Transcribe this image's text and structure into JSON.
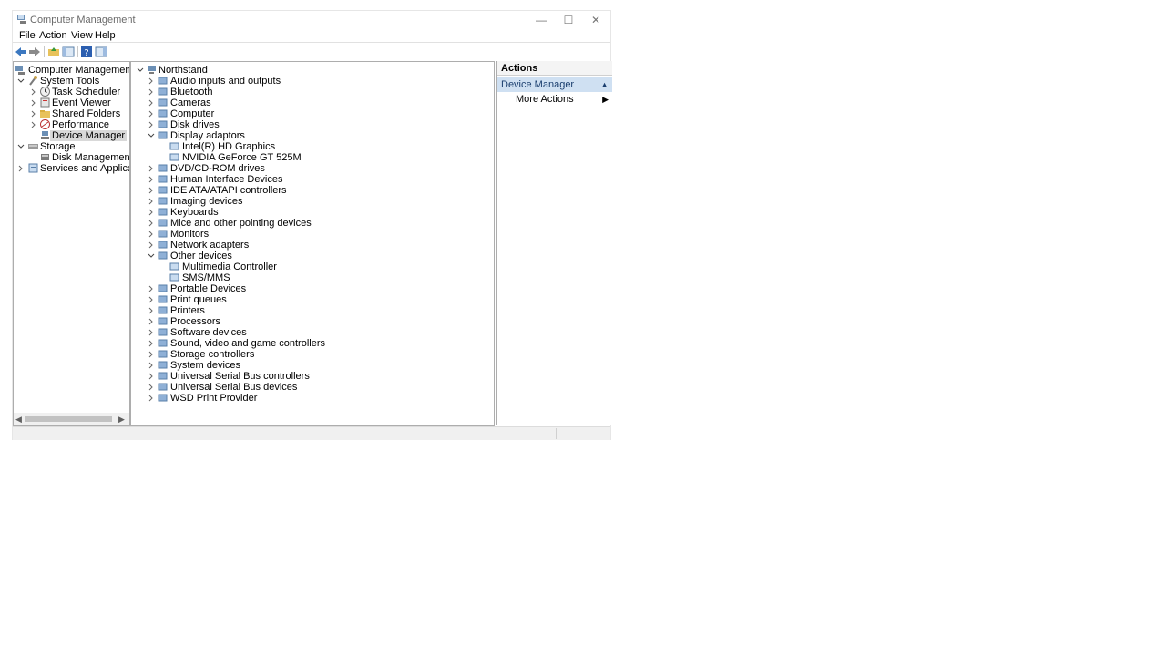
{
  "window": {
    "title": "Computer Management"
  },
  "menu": [
    "File",
    "Action",
    "View",
    "Help"
  ],
  "left_tree": {
    "root": "Computer Management (Local",
    "items": [
      {
        "label": "System Tools",
        "level": 1,
        "expanded": true
      },
      {
        "label": "Task Scheduler",
        "level": 2
      },
      {
        "label": "Event Viewer",
        "level": 2
      },
      {
        "label": "Shared Folders",
        "level": 2
      },
      {
        "label": "Performance",
        "level": 2
      },
      {
        "label": "Device Manager",
        "level": 2,
        "selected": true
      },
      {
        "label": "Storage",
        "level": 1,
        "expanded": true
      },
      {
        "label": "Disk Management",
        "level": 2
      },
      {
        "label": "Services and Applications",
        "level": 1
      }
    ]
  },
  "device_tree": {
    "root": "Northstand",
    "items": [
      {
        "label": "Audio inputs and outputs"
      },
      {
        "label": "Bluetooth"
      },
      {
        "label": "Cameras"
      },
      {
        "label": "Computer"
      },
      {
        "label": "Disk drives"
      },
      {
        "label": "Display adaptors",
        "expanded": true,
        "children": [
          "Intel(R) HD Graphics",
          "NVIDIA GeForce GT 525M"
        ]
      },
      {
        "label": "DVD/CD-ROM drives"
      },
      {
        "label": "Human Interface Devices"
      },
      {
        "label": "IDE ATA/ATAPI controllers"
      },
      {
        "label": "Imaging devices"
      },
      {
        "label": "Keyboards"
      },
      {
        "label": "Mice and other pointing devices"
      },
      {
        "label": "Monitors"
      },
      {
        "label": "Network adapters"
      },
      {
        "label": "Other devices",
        "expanded": true,
        "children": [
          "Multimedia Controller",
          "SMS/MMS"
        ]
      },
      {
        "label": "Portable Devices"
      },
      {
        "label": "Print queues"
      },
      {
        "label": "Printers"
      },
      {
        "label": "Processors"
      },
      {
        "label": "Software devices"
      },
      {
        "label": "Sound, video and game controllers"
      },
      {
        "label": "Storage controllers"
      },
      {
        "label": "System devices"
      },
      {
        "label": "Universal Serial Bus controllers"
      },
      {
        "label": "Universal Serial Bus devices"
      },
      {
        "label": "WSD Print Provider"
      }
    ]
  },
  "actions": {
    "header": "Actions",
    "section": "Device Manager",
    "more": "More Actions"
  },
  "colors": {
    "accent": "#cfe0f2",
    "selection": "#d9d9d9"
  }
}
